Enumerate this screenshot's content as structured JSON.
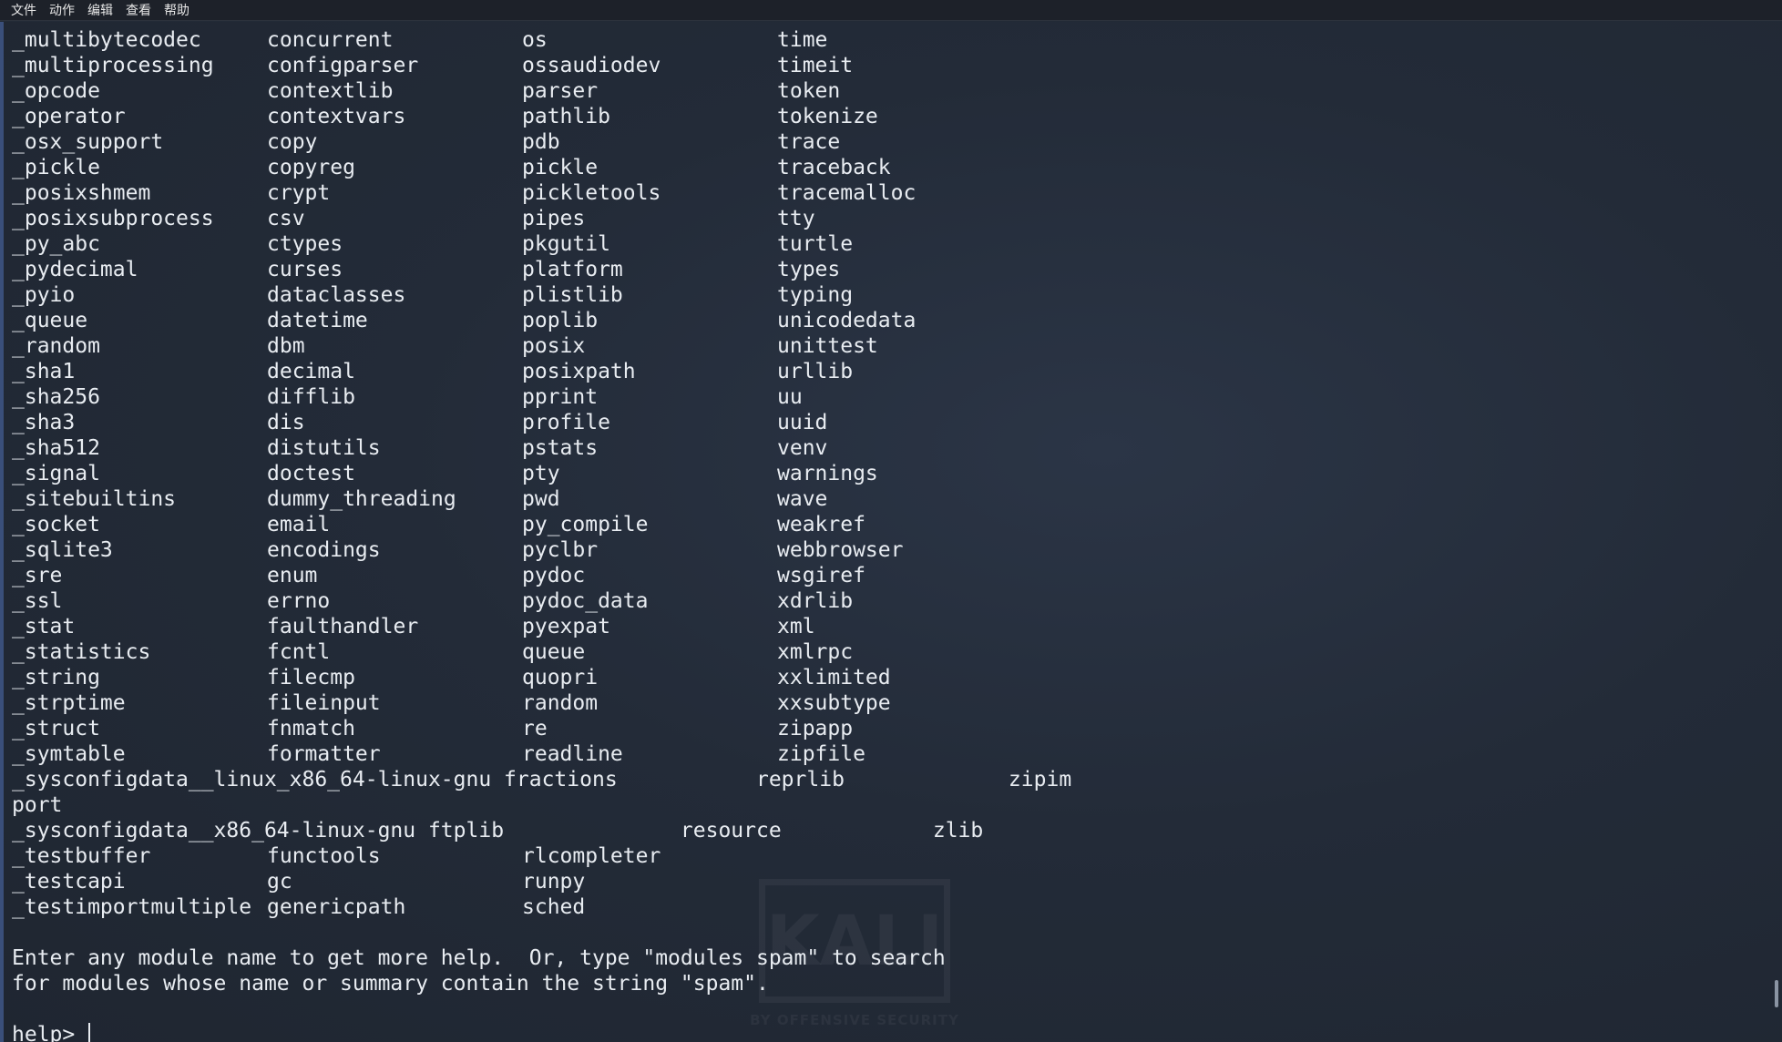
{
  "menubar": {
    "items": [
      "文件",
      "动作",
      "编辑",
      "查看",
      "帮助"
    ]
  },
  "terminal": {
    "module_rows": [
      [
        "_multibytecodec",
        "concurrent",
        "os",
        "time"
      ],
      [
        "_multiprocessing",
        "configparser",
        "ossaudiodev",
        "timeit"
      ],
      [
        "_opcode",
        "contextlib",
        "parser",
        "token"
      ],
      [
        "_operator",
        "contextvars",
        "pathlib",
        "tokenize"
      ],
      [
        "_osx_support",
        "copy",
        "pdb",
        "trace"
      ],
      [
        "_pickle",
        "copyreg",
        "pickle",
        "traceback"
      ],
      [
        "_posixshmem",
        "crypt",
        "pickletools",
        "tracemalloc"
      ],
      [
        "_posixsubprocess",
        "csv",
        "pipes",
        "tty"
      ],
      [
        "_py_abc",
        "ctypes",
        "pkgutil",
        "turtle"
      ],
      [
        "_pydecimal",
        "curses",
        "platform",
        "types"
      ],
      [
        "_pyio",
        "dataclasses",
        "plistlib",
        "typing"
      ],
      [
        "_queue",
        "datetime",
        "poplib",
        "unicodedata"
      ],
      [
        "_random",
        "dbm",
        "posix",
        "unittest"
      ],
      [
        "_sha1",
        "decimal",
        "posixpath",
        "urllib"
      ],
      [
        "_sha256",
        "difflib",
        "pprint",
        "uu"
      ],
      [
        "_sha3",
        "dis",
        "profile",
        "uuid"
      ],
      [
        "_sha512",
        "distutils",
        "pstats",
        "venv"
      ],
      [
        "_signal",
        "doctest",
        "pty",
        "warnings"
      ],
      [
        "_sitebuiltins",
        "dummy_threading",
        "pwd",
        "wave"
      ],
      [
        "_socket",
        "email",
        "py_compile",
        "weakref"
      ],
      [
        "_sqlite3",
        "encodings",
        "pyclbr",
        "webbrowser"
      ],
      [
        "_sre",
        "enum",
        "pydoc",
        "wsgiref"
      ],
      [
        "_ssl",
        "errno",
        "pydoc_data",
        "xdrlib"
      ],
      [
        "_stat",
        "faulthandler",
        "pyexpat",
        "xml"
      ],
      [
        "_statistics",
        "fcntl",
        "queue",
        "xmlrpc"
      ],
      [
        "_string",
        "filecmp",
        "quopri",
        "xxlimited"
      ],
      [
        "_strptime",
        "fileinput",
        "random",
        "xxsubtype"
      ],
      [
        "_struct",
        "fnmatch",
        "re",
        "zipapp"
      ],
      [
        "_symtable",
        "formatter",
        "readline",
        "zipfile"
      ]
    ],
    "wrapped_lines": [
      "_sysconfigdata__linux_x86_64-linux-gnu fractions           reprlib             zipim",
      "port",
      "_sysconfigdata__x86_64-linux-gnu ftplib              resource            zlib"
    ],
    "tail_rows": [
      [
        "_testbuffer",
        "functools",
        "rlcompleter",
        ""
      ],
      [
        "_testcapi",
        "gc",
        "runpy",
        ""
      ],
      [
        "_testimportmultiple",
        "genericpath",
        "sched",
        ""
      ]
    ],
    "help_line_1": "Enter any module name to get more help.  Or, type \"modules spam\" to search",
    "help_line_2": "for modules whose name or summary contain the string \"spam\".",
    "prompt": "help> "
  },
  "watermark": {
    "logo": "KALI",
    "tagline": "BY OFFENSIVE SECURITY"
  },
  "colors": {
    "background": "#222a36",
    "text": "#e8ecf1",
    "menubar": "#1d2129"
  }
}
